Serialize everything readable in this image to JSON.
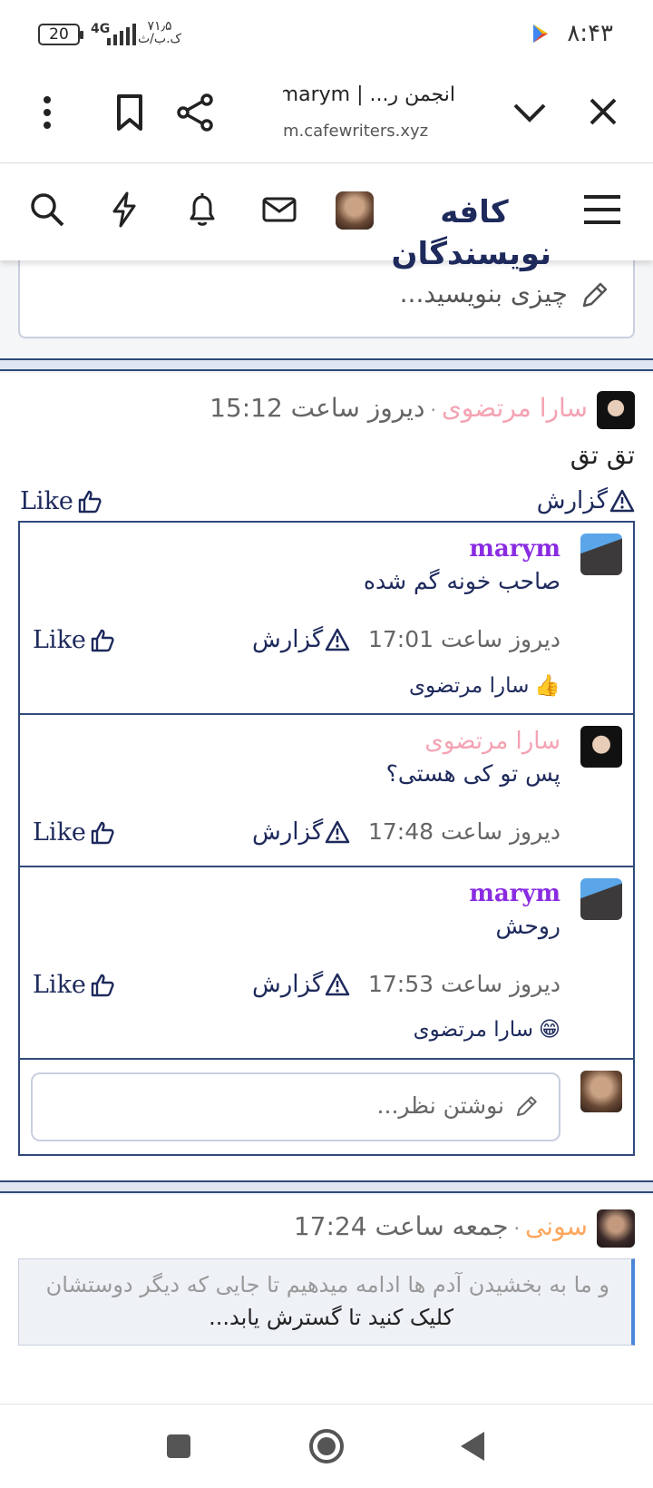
{
  "status_bar": {
    "time": "۸:۴۳",
    "battery": "20",
    "network": "4G",
    "speed_value": "۷۱٫۵",
    "speed_unit": "ک.ب/ث"
  },
  "browser": {
    "tab_title": "انجمن ر... | marym",
    "url": "m.cafewriters.xyz"
  },
  "site": {
    "logo_text": "کافه نویسندگان"
  },
  "composer": {
    "placeholder": "چیزی بنویسید..."
  },
  "post1": {
    "author": "سارا مرتضوی",
    "time": "دیروز ساعت 15:12",
    "body": "تق تق",
    "report_label": "گزارش",
    "like_label": "Like",
    "comments": [
      {
        "author": "marym",
        "text": "صاحب خونه گم شده",
        "time": "دیروز ساعت 17:01",
        "report_label": "گزارش",
        "like_label": "Like",
        "reaction_emoji": "👍",
        "reaction_user": "سارا مرتضوی"
      },
      {
        "author": "سارا مرتضوی",
        "text": "پس تو کی هستی؟",
        "time": "دیروز ساعت 17:48",
        "report_label": "گزارش",
        "like_label": "Like"
      },
      {
        "author": "marym",
        "text": "روحش",
        "time": "دیروز ساعت 17:53",
        "report_label": "گزارش",
        "like_label": "Like",
        "reaction_emoji": "😁",
        "reaction_user": "سارا مرتضوی"
      }
    ],
    "comment_placeholder": "نوشتن نظر..."
  },
  "post2": {
    "author": "سونی",
    "time": "جمعه ساعت 17:24",
    "quote_line": "و ما به بخشیدن آدم ها ادامه میدهیم تا جایی که دیگر دوستشان",
    "quote_more": "کلیک کنید تا گسترش یابد..."
  }
}
